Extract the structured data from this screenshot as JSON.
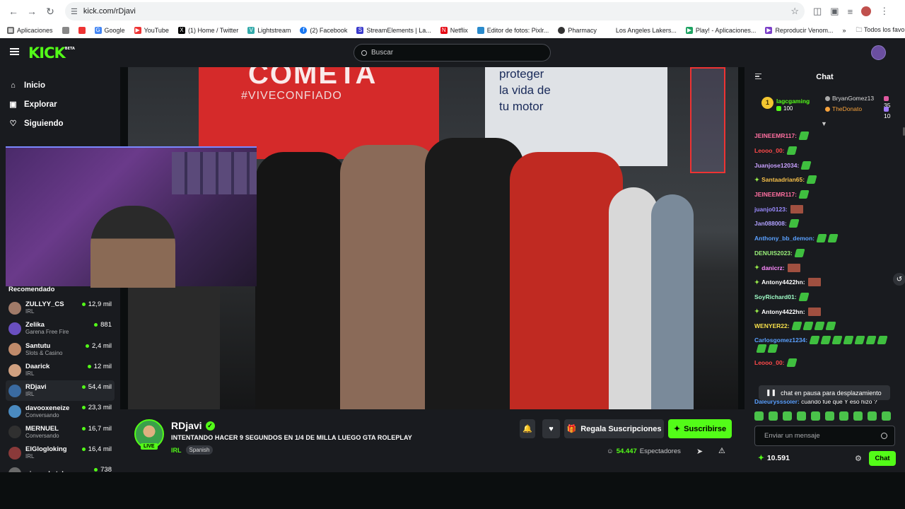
{
  "browser": {
    "url": "kick.com/rDjavi",
    "bookmarks": [
      "Aplicaciones",
      "Google",
      "YouTube",
      "(1) Home / Twitter",
      "Lightstream",
      "(2) Facebook",
      "StreamElements | La...",
      "Netflix",
      "Editor de fotos: Pixlr...",
      "Pharmacy",
      "Los Angeles Lakers...",
      "Play! - Aplicaciones...",
      "Reproducir Venom..."
    ],
    "all_bookmarks": "Todos los favoritos"
  },
  "topbar": {
    "logo": "KICK",
    "logo_beta": "BETA",
    "search_placeholder": "Buscar"
  },
  "sidebar": {
    "nav": [
      {
        "label": "Inicio",
        "icon": "home-icon"
      },
      {
        "label": "Explorar",
        "icon": "compass-icon"
      },
      {
        "label": "Siguiendo",
        "icon": "heart-icon"
      }
    ],
    "recommended_title": "Recomendado",
    "recommended": [
      {
        "name": "ZULLYY_CS",
        "category": "IRL",
        "viewers": "12,9 mil",
        "color": "#a07a68"
      },
      {
        "name": "Zelika",
        "category": "Garena Free Fire",
        "viewers": "881",
        "color": "#6a4fc0"
      },
      {
        "name": "Santutu",
        "category": "Slots & Casino",
        "viewers": "2,4 mil",
        "color": "#c08a6a"
      },
      {
        "name": "Daarick",
        "category": "IRL",
        "viewers": "12 mil",
        "color": "#d0a080"
      },
      {
        "name": "RDjavi",
        "category": "IRL",
        "viewers": "54,4 mil",
        "color": "#3a6aa0"
      },
      {
        "name": "davooxeneize",
        "category": "Conversando",
        "viewers": "23,3 mil",
        "color": "#4a8ac0"
      },
      {
        "name": "MERNUEL",
        "category": "Conversando",
        "viewers": "16,7 mil",
        "color": "#303030"
      },
      {
        "name": "ElGlogloking",
        "category": "IRL",
        "viewers": "16,4 mil",
        "color": "#8a3a3a"
      },
      {
        "name": "pipewakatela",
        "category": "",
        "viewers": "738",
        "color": "#6a6a6a"
      }
    ]
  },
  "video": {
    "billboard_1": "COMETA",
    "billboard_1_sub": "#VIVECONFIADO",
    "billboard_2": "proteger\nla vida de\ntu motor"
  },
  "stream": {
    "channel": "RDjavi",
    "live_badge": "LIVE",
    "title": "INTENTANDO HACER 9 SEGUNDOS EN 1/4 DE MILLA  LUEGO GTA ROLEPLAY",
    "category": "IRL",
    "language": "Spanish",
    "gift_label": "Regala Suscripciones",
    "subscribe_label": "Suscribirse",
    "viewers": "54.447",
    "viewers_label": "Espectadores"
  },
  "chat": {
    "title": "Chat",
    "leaderboard": [
      {
        "rank": "1",
        "name": "lagcgaming",
        "value": "100"
      },
      {
        "name": "BryanGomez13",
        "value": "35"
      },
      {
        "name": "TheDonato",
        "value": "10"
      }
    ],
    "messages": [
      {
        "user": "JEINEEMR117:",
        "color": "#ff6fa0",
        "emotes": 1,
        "kind": "g"
      },
      {
        "user": "Leooo_00:",
        "color": "#ff4a4a",
        "emotes": 1,
        "kind": "g"
      },
      {
        "user": "Juanjose12034:",
        "color": "#c8a0ff",
        "emotes": 1,
        "kind": "g"
      },
      {
        "user": "Santaadrian65:",
        "color": "#f7c04a",
        "emotes": 1,
        "kind": "g",
        "badge": true
      },
      {
        "user": "JEINEEMR117:",
        "color": "#ff6fa0",
        "emotes": 1,
        "kind": "g"
      },
      {
        "user": "juanjo0123:",
        "color": "#9a8aff",
        "emotes": 1,
        "kind": "k"
      },
      {
        "user": "Jan088008:",
        "color": "#b0a0ff",
        "emotes": 1,
        "kind": "g"
      },
      {
        "user": "Anthony_bb_demon:",
        "color": "#5aa0ff",
        "emotes": 2,
        "kind": "g"
      },
      {
        "user": "DENUIS2023:",
        "color": "#9af07a",
        "emotes": 1,
        "kind": "g"
      },
      {
        "user": "danicrz:",
        "color": "#ff8aff",
        "emotes": 1,
        "kind": "k",
        "badge": true
      },
      {
        "user": "Antony4422hn:",
        "color": "#ffffff",
        "emotes": 1,
        "kind": "k",
        "badge": true
      },
      {
        "user": "SoyRichard01:",
        "color": "#a0ffc8",
        "emotes": 1,
        "kind": "g"
      },
      {
        "user": "Antony4422hn:",
        "color": "#ffffff",
        "emotes": 1,
        "kind": "k",
        "badge": true
      },
      {
        "user": "WENYER22:",
        "color": "#f7e04a",
        "emotes": 4,
        "kind": "g"
      },
      {
        "user": "Carlosgomez1234:",
        "color": "#5aa0ff",
        "emotes": 9,
        "kind": "g"
      },
      {
        "user": "Leooo_00:",
        "color": "#ff4a4a",
        "emotes": 1,
        "kind": "g"
      }
    ],
    "last_message_user": "Daleurysssoler:",
    "last_message_text": "cuando fue que Y eso hizo ?",
    "paused_label": "chat en pausa para desplazamiento",
    "input_placeholder": "Enviar un mensaje",
    "points": "10.591",
    "chat_button": "Chat"
  }
}
